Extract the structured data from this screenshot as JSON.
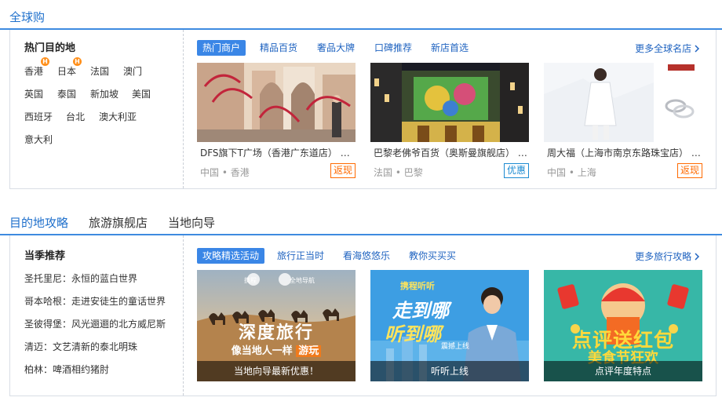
{
  "section1": {
    "title": "全球购",
    "left_title": "热门目的地",
    "destinations": [
      {
        "label": "香港",
        "badge": "H"
      },
      {
        "label": "日本",
        "badge": "H"
      },
      {
        "label": "法国",
        "badge": ""
      },
      {
        "label": "澳门",
        "badge": ""
      },
      {
        "label": "英国",
        "badge": ""
      },
      {
        "label": "泰国",
        "badge": ""
      },
      {
        "label": "新加坡",
        "badge": ""
      },
      {
        "label": "美国",
        "badge": ""
      },
      {
        "label": "西班牙",
        "badge": ""
      },
      {
        "label": "台北",
        "badge": ""
      },
      {
        "label": "澳大利亚",
        "badge": ""
      },
      {
        "label": "意大利",
        "badge": ""
      }
    ],
    "tabs": [
      "热门商户",
      "精品百货",
      "奢品大牌",
      "口碑推荐",
      "新店首选"
    ],
    "more": "更多全球名店",
    "cards": [
      {
        "name": "DFS旗下T广场（香港广东道店） DFS旗下T广场",
        "location": "中国 • 香港",
        "badge": "返现",
        "badge_color": "#ff6a00"
      },
      {
        "name": "巴黎老佛爷百货（奥斯曼旗舰店） Galeries Lafayette",
        "location": "法国 • 巴黎",
        "badge": "优惠",
        "badge_color": "#1b8ad1"
      },
      {
        "name": "周大福（上海市南京东路珠宝店） Chow Tai Fook",
        "location": "中国 • 上海",
        "badge": "返现",
        "badge_color": "#ff6a00"
      }
    ]
  },
  "section2": {
    "tabs": [
      "目的地攻略",
      "旅游旗舰店",
      "当地向导"
    ],
    "left_title": "当季推荐",
    "season_items": [
      "圣托里尼：永恒的蓝白世界",
      "哥本哈根：走进安徒生的童话世界",
      "圣彼得堡：风光逦逦的北方威尼斯",
      "清迈：文艺清新的泰北明珠",
      "柏林：啤酒相约猪肘"
    ],
    "sub_tabs": [
      "攻略精选活动",
      "旅行正当时",
      "看海悠悠乐",
      "教你买买买"
    ],
    "more": "更多旅行攻略",
    "guides": [
      {
        "caption": "当地向导最新优惠！",
        "img_title": "深度旅行",
        "img_sub": "像当地人一样",
        "img_hl": "游玩",
        "logo_a": "携程",
        "logo_b": "全地导航"
      },
      {
        "caption": "听听上线",
        "img_brand": "携程听听",
        "img_title": "走到哪",
        "img_title2": "听到哪",
        "img_sub": "震撼上线"
      },
      {
        "caption": "点评年度特点",
        "img_title": "点评送红包",
        "img_sub": "美食节狂欢"
      }
    ]
  },
  "icons": {
    "chevron": "chevron-right-icon"
  }
}
